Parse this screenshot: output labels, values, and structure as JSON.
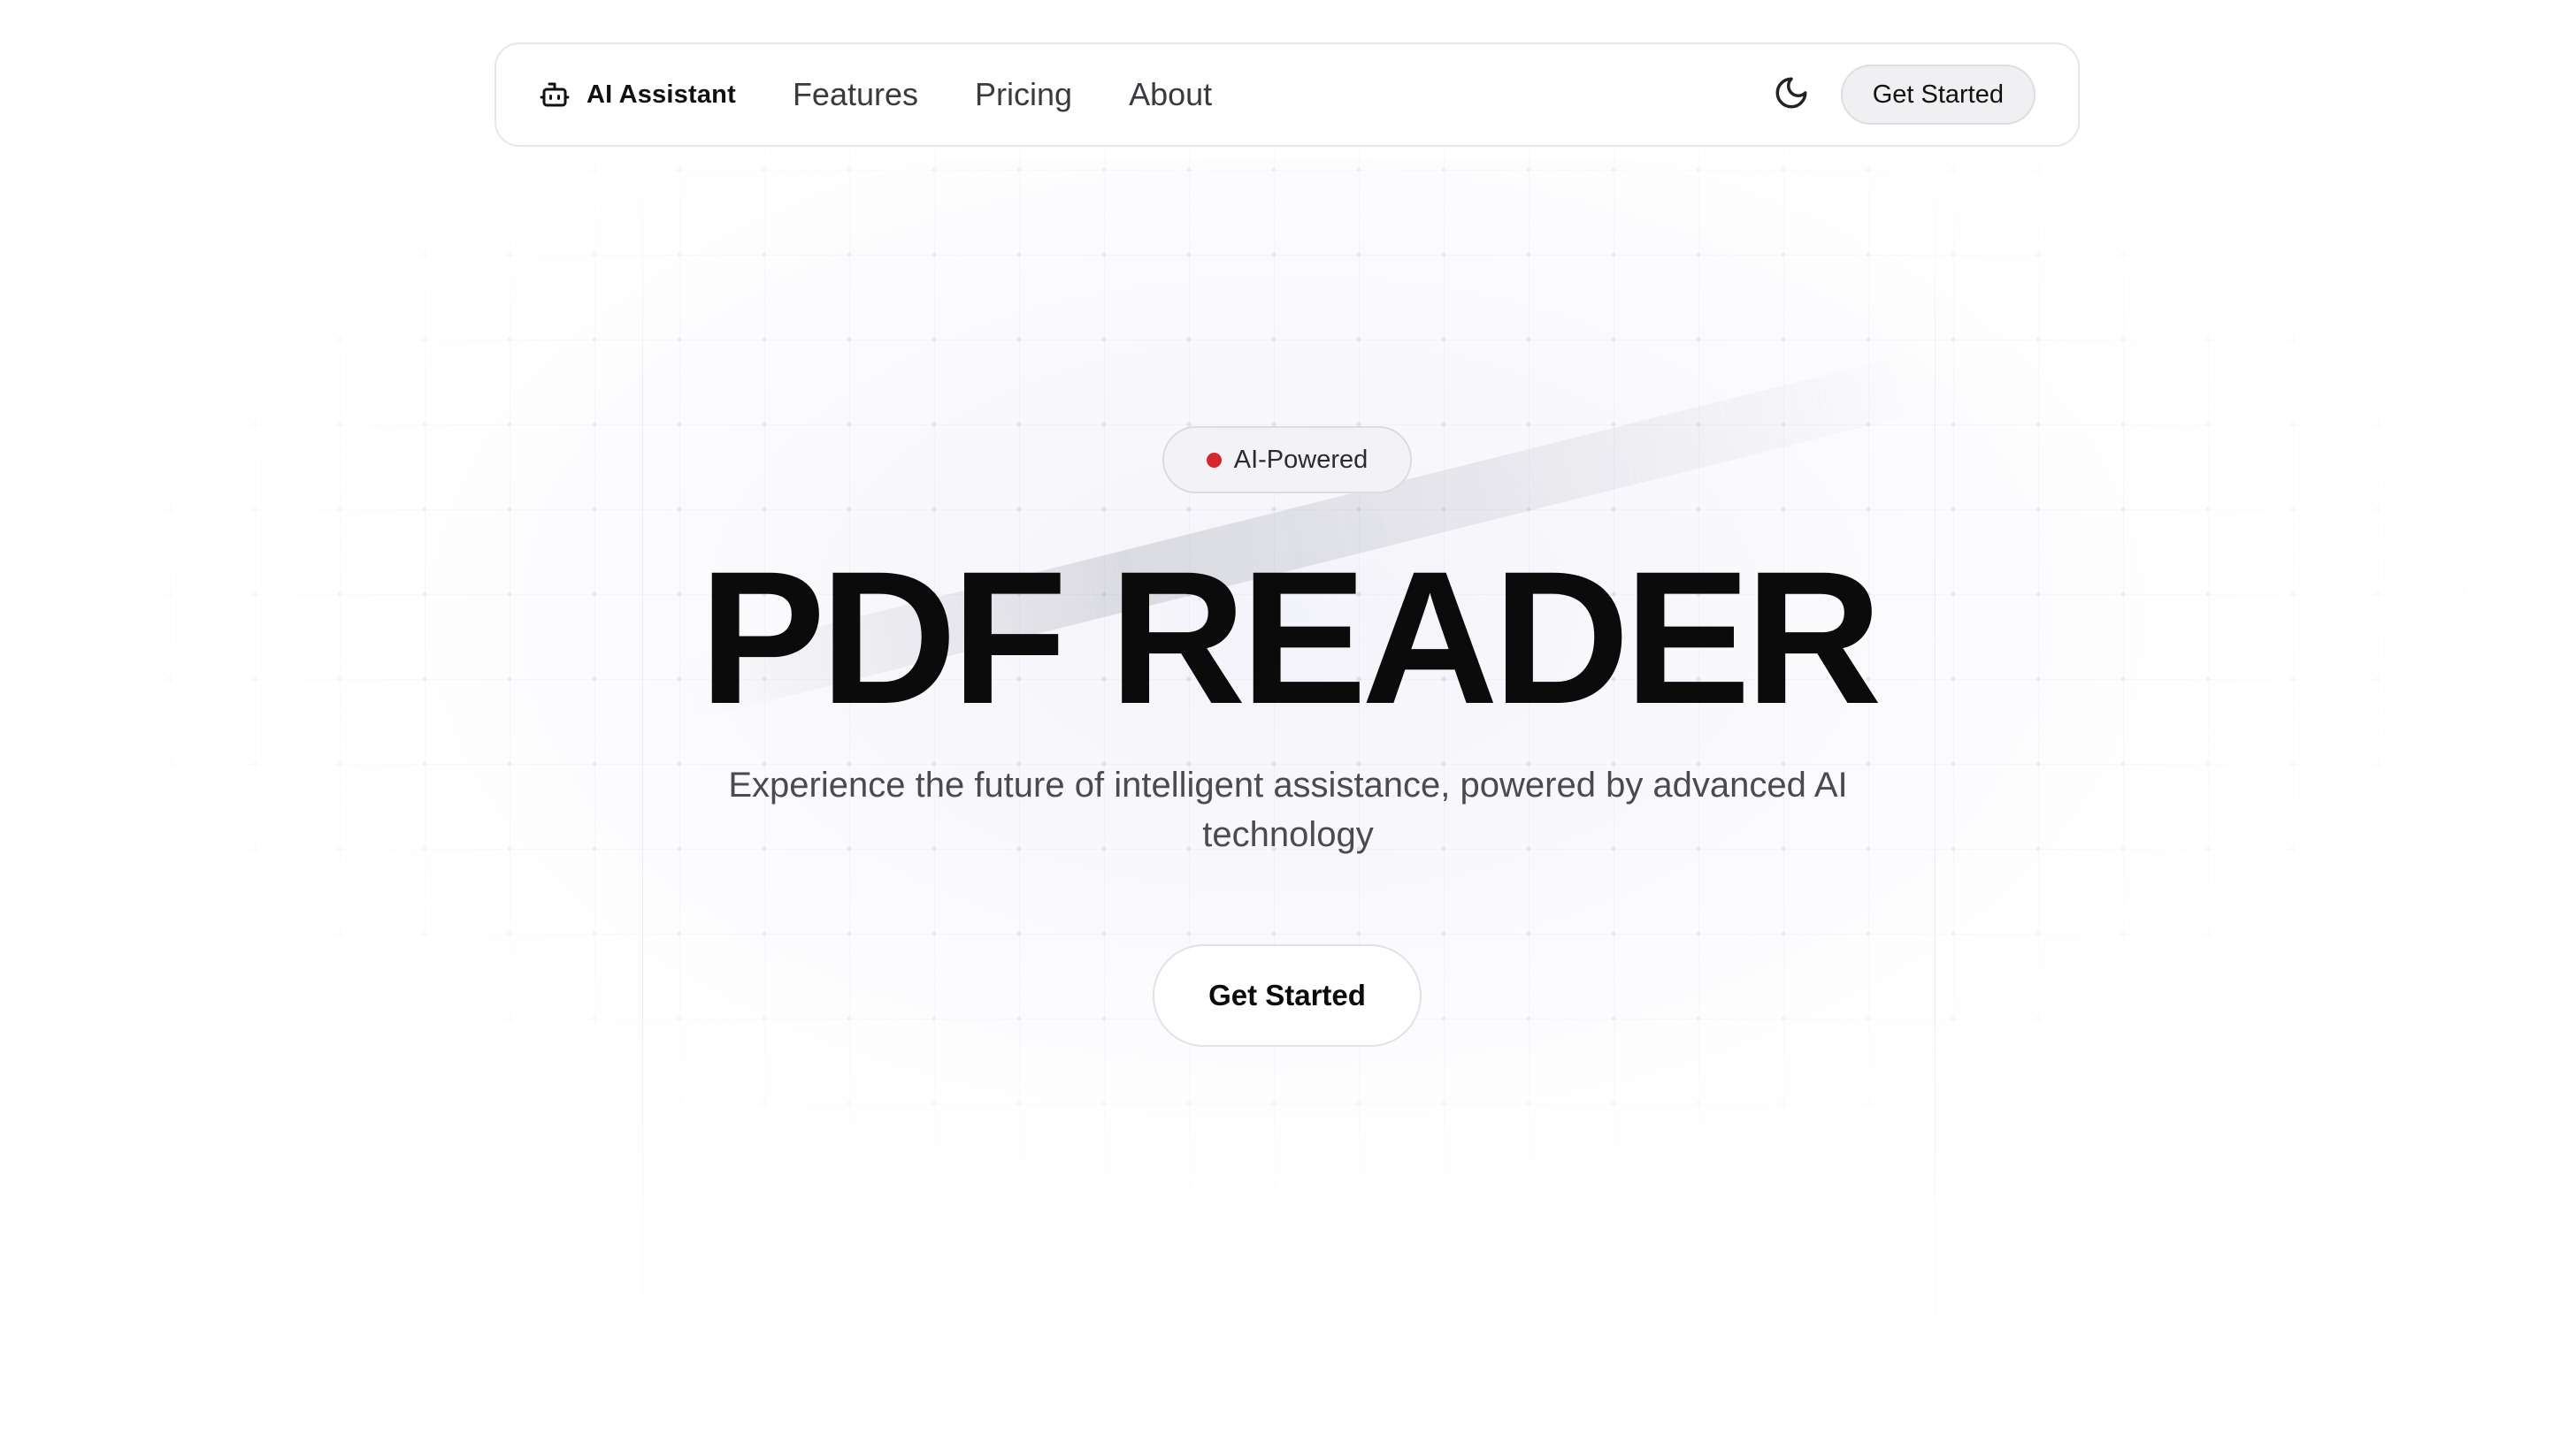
{
  "navbar": {
    "brand": {
      "label": "AI Assistant",
      "icon": "robot-icon"
    },
    "links": [
      {
        "label": "Features"
      },
      {
        "label": "Pricing"
      },
      {
        "label": "About"
      }
    ],
    "theme_toggle_icon": "moon-icon",
    "cta_label": "Get Started"
  },
  "hero": {
    "badge": {
      "label": "AI-Powered",
      "dot_color": "#d6282c"
    },
    "title": "PDF READER",
    "subtitle": "Experience the future of intelligent assistance, powered by advanced AI technology",
    "cta_label": "Get Started"
  }
}
